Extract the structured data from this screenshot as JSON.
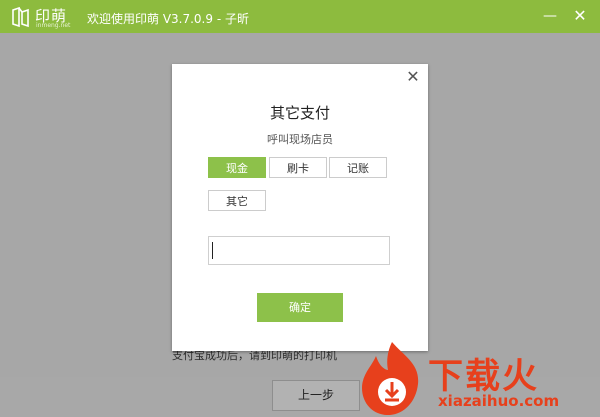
{
  "window": {
    "logo_text": "印萌",
    "logo_subtext": "inmeng.net",
    "title": "欢迎使用印萌 V3.7.0.9 - 子昕",
    "minimize_icon": "minimize-icon",
    "close_icon": "close-icon"
  },
  "background": {
    "partial_text": "支付宝成功后，请到印萌的打印机",
    "prev_button": "上一步"
  },
  "dialog": {
    "title": "其它支付",
    "subtitle": "呼叫现场店员",
    "close_icon": "close-icon",
    "payment_options": [
      {
        "label": "现金",
        "selected": true
      },
      {
        "label": "刷卡",
        "selected": false
      },
      {
        "label": "记账",
        "selected": false
      },
      {
        "label": "其它",
        "selected": false
      }
    ],
    "input_value": "",
    "input_placeholder": "",
    "confirm_button": "确定"
  },
  "watermark": {
    "text": "下载火",
    "url": "xiazaihuo.com"
  },
  "colors": {
    "accent": "#8dc14a",
    "titlebar": "#8dbb3e",
    "overlay": "#a7a7a7",
    "watermark": "#e7401c"
  }
}
